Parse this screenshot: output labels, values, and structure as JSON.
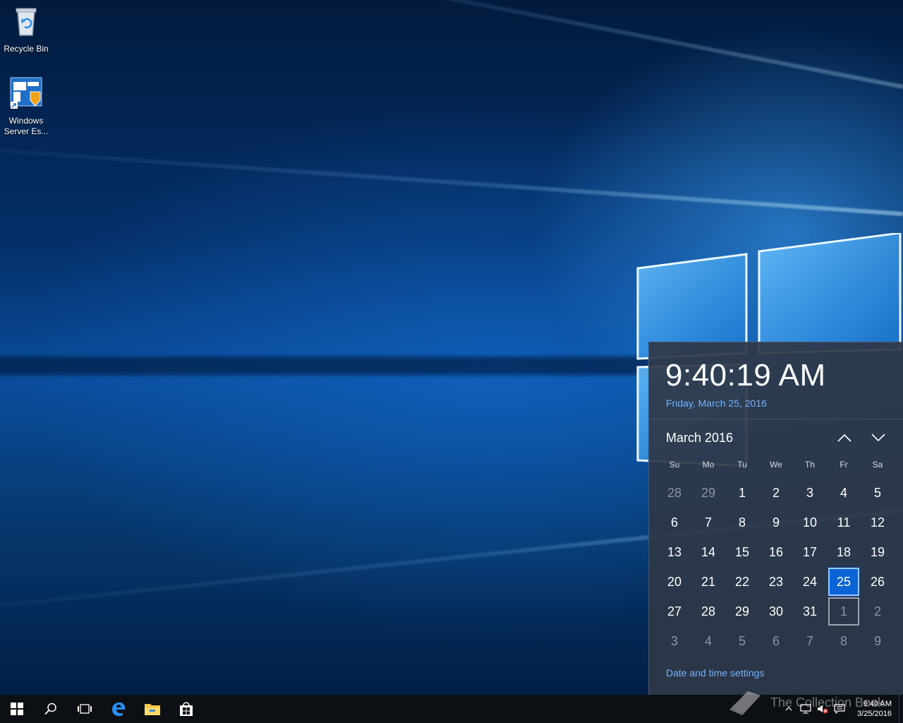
{
  "desktop": {
    "icons": [
      {
        "label": "Recycle Bin"
      },
      {
        "label": "Windows Server Es..."
      }
    ]
  },
  "flyout": {
    "time": "9:40:19 AM",
    "date": "Friday, March 25, 2016",
    "month_label": "March 2016",
    "weekdays": [
      "Su",
      "Mo",
      "Tu",
      "We",
      "Th",
      "Fr",
      "Sa"
    ],
    "days": [
      {
        "n": "28",
        "other": true
      },
      {
        "n": "29",
        "other": true
      },
      {
        "n": "1"
      },
      {
        "n": "2"
      },
      {
        "n": "3"
      },
      {
        "n": "4"
      },
      {
        "n": "5"
      },
      {
        "n": "6"
      },
      {
        "n": "7"
      },
      {
        "n": "8"
      },
      {
        "n": "9"
      },
      {
        "n": "10"
      },
      {
        "n": "11"
      },
      {
        "n": "12"
      },
      {
        "n": "13"
      },
      {
        "n": "14"
      },
      {
        "n": "15"
      },
      {
        "n": "16"
      },
      {
        "n": "17"
      },
      {
        "n": "18"
      },
      {
        "n": "19"
      },
      {
        "n": "20"
      },
      {
        "n": "21"
      },
      {
        "n": "22"
      },
      {
        "n": "23"
      },
      {
        "n": "24"
      },
      {
        "n": "25",
        "today": true
      },
      {
        "n": "26"
      },
      {
        "n": "27"
      },
      {
        "n": "28"
      },
      {
        "n": "29"
      },
      {
        "n": "30"
      },
      {
        "n": "31"
      },
      {
        "n": "1",
        "other": true,
        "focus": true
      },
      {
        "n": "2",
        "other": true
      },
      {
        "n": "3",
        "other": true
      },
      {
        "n": "4",
        "other": true
      },
      {
        "n": "5",
        "other": true
      },
      {
        "n": "6",
        "other": true
      },
      {
        "n": "7",
        "other": true
      },
      {
        "n": "8",
        "other": true
      },
      {
        "n": "9",
        "other": true
      }
    ],
    "settings_link": "Date and time settings"
  },
  "taskbar": {
    "watermark": "The Collection Book",
    "clock_time": "9:40 AM",
    "clock_date": "3/25/2016"
  },
  "colors": {
    "accent": "#0a64d6",
    "link": "#6fb3ff",
    "taskbar": "#0c0f14"
  }
}
